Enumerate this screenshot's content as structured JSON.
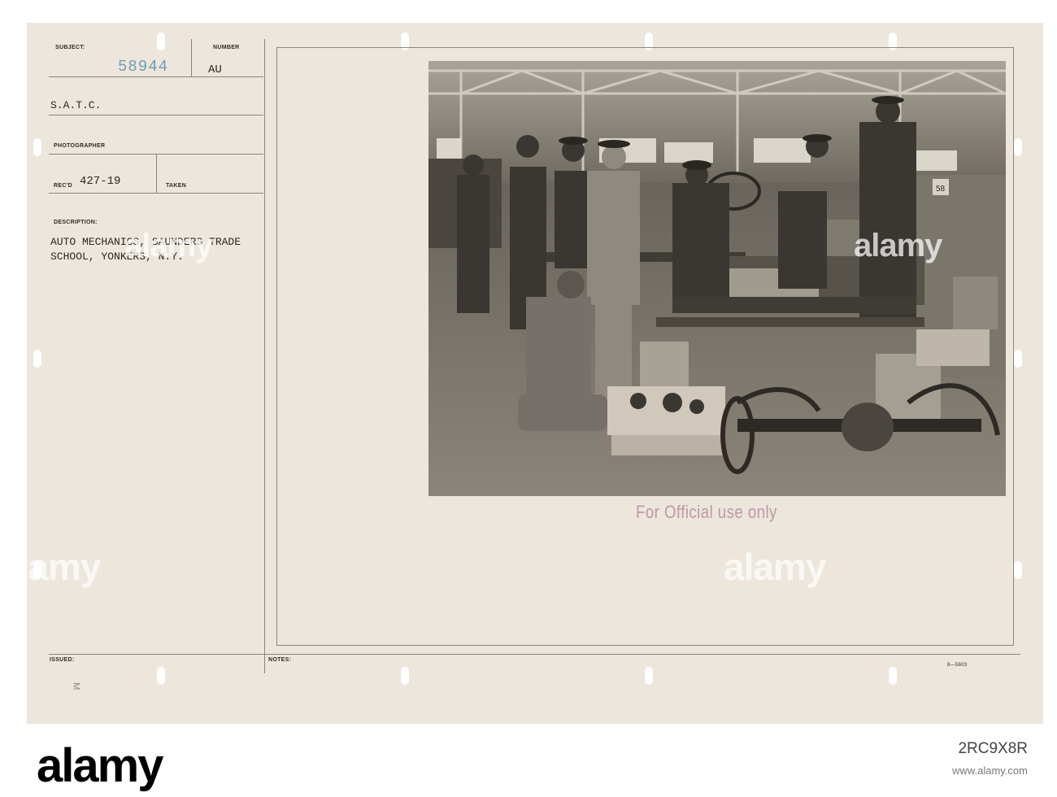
{
  "card": {
    "subject_label": "SUBJECT:",
    "number_label": "NUMBER",
    "subject_number": "58944",
    "number_value": "AU",
    "unit": "S.A.T.C.",
    "photographer_label": "PHOTOGRAPHER",
    "recd_label": "REC'D",
    "recd_value": "427-19",
    "taken_label": "TAKEN",
    "description_label": "DESCRIPTION:",
    "description_line1": "AUTO MECHANICS, SAUNDERS TRADE",
    "description_line2": "SCHOOL, YONKERS, N.Y.",
    "issued_label": "ISSUED:",
    "notes_label": "NOTES:",
    "form_code": "8—5603",
    "margin_mark": "M",
    "stamp": "For Official use only"
  },
  "watermark": {
    "text": "alamy"
  },
  "banner": {
    "logo": "alamy",
    "image_id": "2RC9X8R",
    "url": "www.alamy.com"
  },
  "colors": {
    "card": "#ece6dc",
    "stamp": "#b58aa0",
    "ink": "#2b2722",
    "number_ink": "#6f9db0"
  }
}
